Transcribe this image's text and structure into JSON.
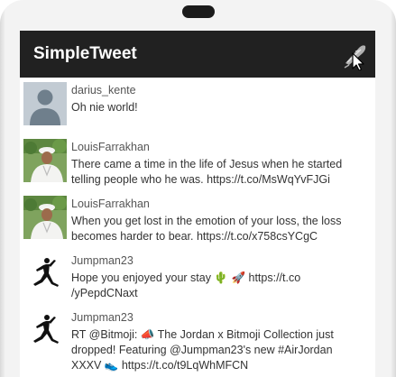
{
  "app": {
    "title": "SimpleTweet",
    "compose_icon": "compose-feather-icon"
  },
  "colors": {
    "appbar": "#212121",
    "appbar_text": "#ffffff",
    "username": "#555555",
    "tweet_text": "#333333"
  },
  "tweets": [
    {
      "username": "darius_kente",
      "avatar": "default-avatar-icon",
      "text": "Oh nie world!"
    },
    {
      "username": "LouisFarrakhan",
      "avatar": "profile-photo",
      "text": "There came a time in the life of Jesus when he started telling people who he was. https://t.co/MsWqYvFJGi"
    },
    {
      "username": "LouisFarrakhan",
      "avatar": "profile-photo",
      "text": "When you get lost in the emotion of your loss, the loss becomes harder to bear. https://t.co/x758csYCgC"
    },
    {
      "username": "Jumpman23",
      "avatar": "jumpman-logo",
      "text": "Hope you enjoyed your stay 🌵 🚀 https://t.co /yPepdCNaxt"
    },
    {
      "username": "Jumpman23",
      "avatar": "jumpman-logo",
      "text": "RT @Bitmoji: 📣 The Jordan x Bitmoji Collection just dropped! Featuring @Jumpman23's new #AirJordan XXXV 👟 https://t.co/t9LqWhMFCN"
    }
  ]
}
